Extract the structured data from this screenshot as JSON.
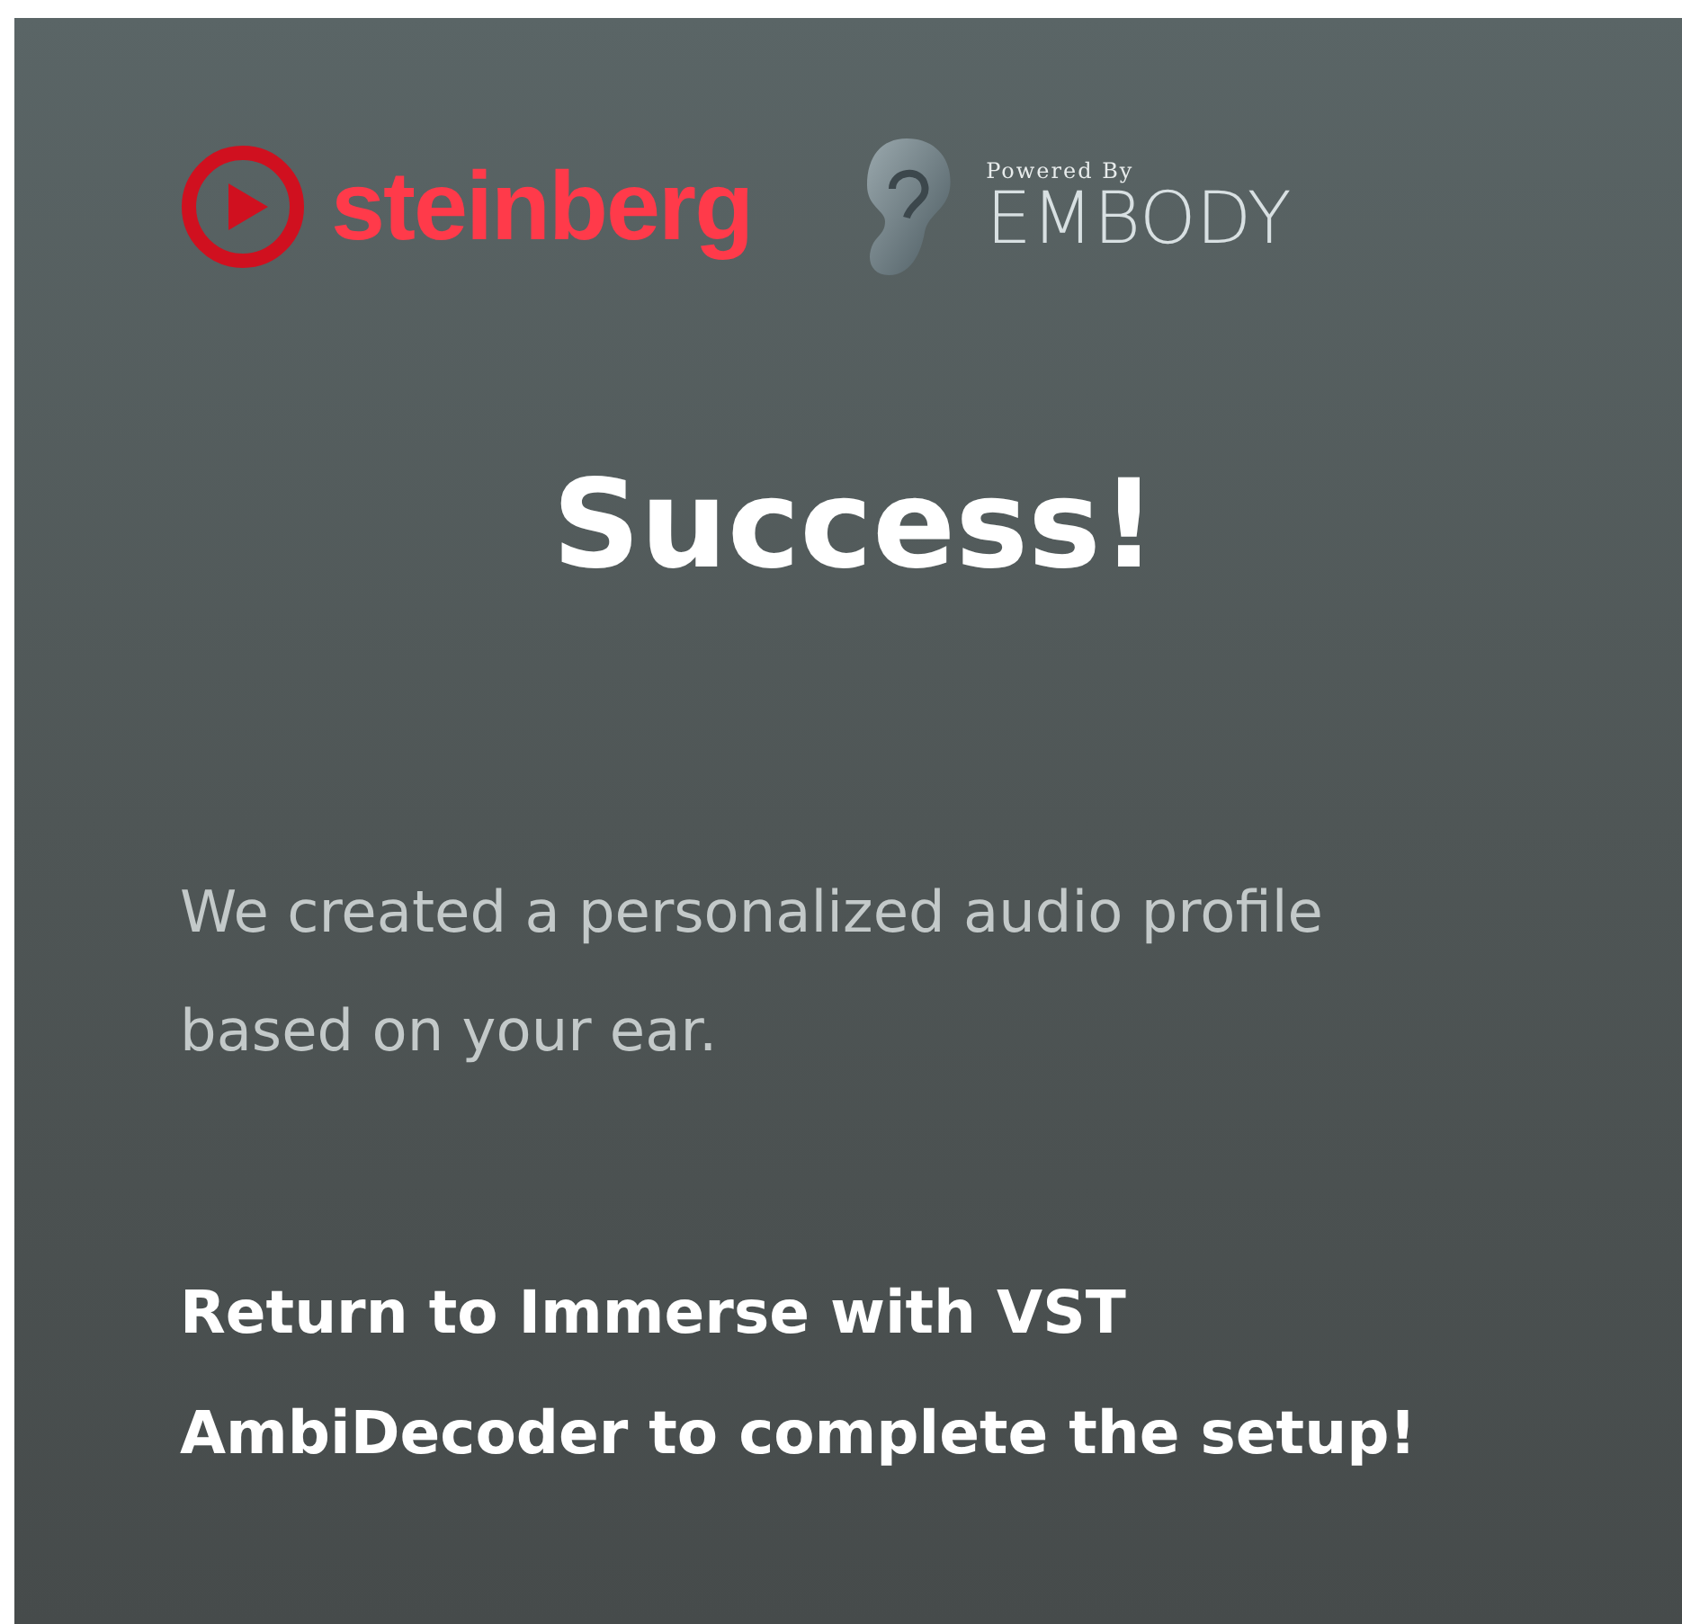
{
  "logos": {
    "steinberg": "steinberg",
    "powered_by": "Powered By",
    "embody": "EMBODY"
  },
  "title": "Success!",
  "message": "We created a personalized audio profile based on your ear.",
  "instruction": "Return to Immerse with VST AmbiDecoder to complete the setup!"
}
